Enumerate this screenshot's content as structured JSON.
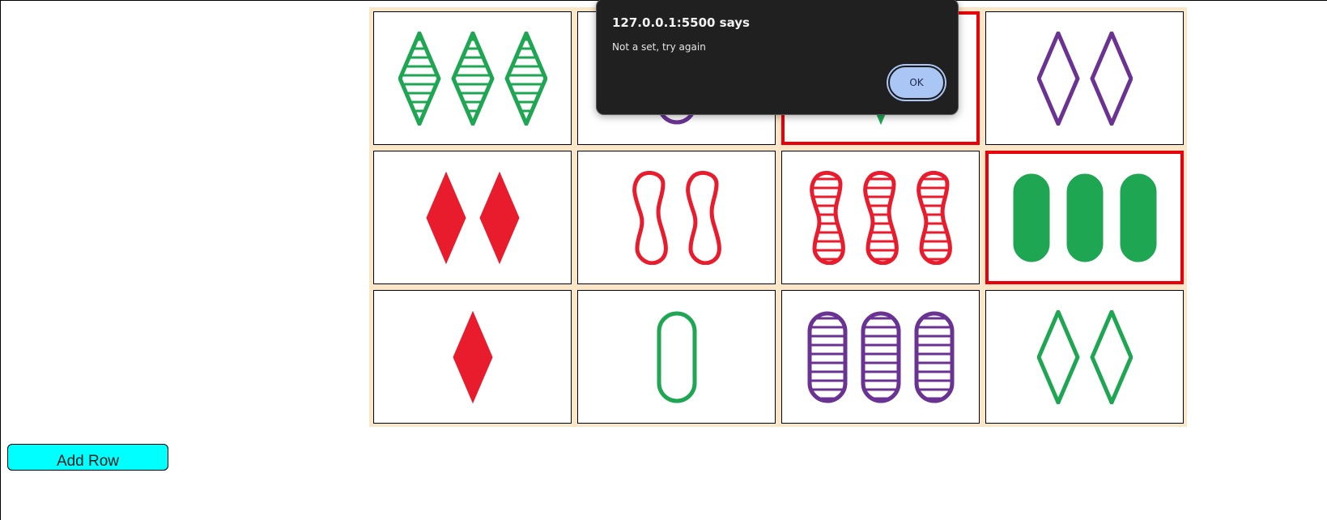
{
  "colors": {
    "green": "#1fa653",
    "purple": "#6a3393",
    "red": "#e81c2c",
    "board_bg": "#fce6c8",
    "selected_border": "#e8000b",
    "button_bg": "#00ffff"
  },
  "board": {
    "cards": [
      {
        "count": 3,
        "shape": "diamond",
        "fill": "striped",
        "color": "green",
        "selected": false
      },
      {
        "count": 1,
        "shape": "oval",
        "fill": "open",
        "color": "purple",
        "selected": false
      },
      {
        "count": 1,
        "shape": "diamond",
        "fill": "solid",
        "color": "green",
        "selected": true
      },
      {
        "count": 2,
        "shape": "diamond",
        "fill": "open",
        "color": "purple",
        "selected": false
      },
      {
        "count": 2,
        "shape": "diamond",
        "fill": "solid",
        "color": "red",
        "selected": false
      },
      {
        "count": 2,
        "shape": "squiggle",
        "fill": "open",
        "color": "red",
        "selected": false
      },
      {
        "count": 3,
        "shape": "squiggle",
        "fill": "striped",
        "color": "red",
        "selected": false
      },
      {
        "count": 3,
        "shape": "oval",
        "fill": "solid",
        "color": "green",
        "selected": true
      },
      {
        "count": 1,
        "shape": "diamond",
        "fill": "solid",
        "color": "red",
        "selected": false
      },
      {
        "count": 1,
        "shape": "oval",
        "fill": "open",
        "color": "green",
        "selected": false
      },
      {
        "count": 3,
        "shape": "oval",
        "fill": "striped",
        "color": "purple",
        "selected": false
      },
      {
        "count": 2,
        "shape": "diamond",
        "fill": "open",
        "color": "green",
        "selected": false
      }
    ]
  },
  "controls": {
    "add_row_label": "Add Row"
  },
  "dialog": {
    "title": "127.0.0.1:5500 says",
    "message": "Not a set, try again",
    "ok_label": "OK"
  }
}
